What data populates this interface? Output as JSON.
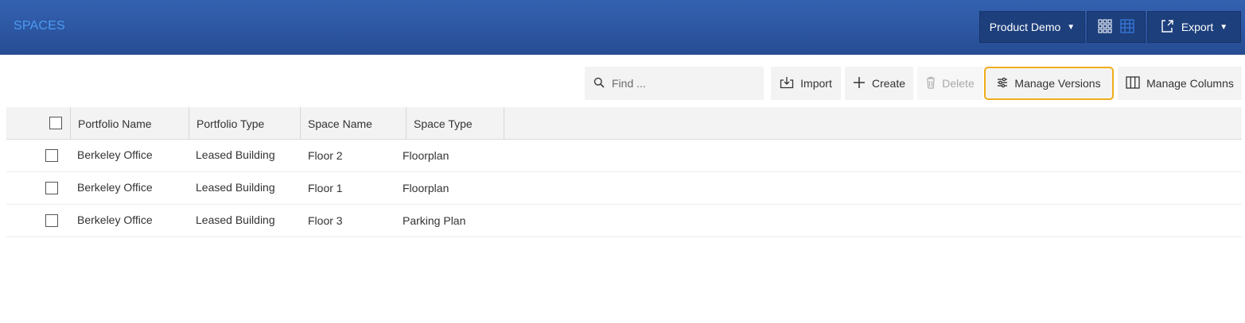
{
  "header": {
    "title": "SPACES",
    "workspace_label": "Product Demo",
    "export_label": "Export"
  },
  "toolbar": {
    "search_placeholder": "Find ...",
    "import_label": "Import",
    "create_label": "Create",
    "delete_label": "Delete",
    "manage_versions_label": "Manage Versions",
    "manage_columns_label": "Manage Columns"
  },
  "table": {
    "columns": [
      "Portfolio Name",
      "Portfolio Type",
      "Space Name",
      "Space Type"
    ],
    "rows": [
      [
        "Berkeley Office",
        "Leased Building",
        "Floor 2",
        "Floorplan"
      ],
      [
        "Berkeley Office",
        "Leased Building",
        "Floor 1",
        "Floorplan"
      ],
      [
        "Berkeley Office",
        "Leased Building",
        "Floor 3",
        "Parking Plan"
      ]
    ]
  },
  "colors": {
    "header_bg": "#2c55a0",
    "title_text": "#4d9af0",
    "highlight_border": "#f0ad1c"
  },
  "icons": [
    "grid-view-icon",
    "table-view-icon",
    "export-icon",
    "search-icon",
    "import-icon",
    "plus-icon",
    "trash-icon",
    "sliders-icon",
    "columns-icon"
  ]
}
